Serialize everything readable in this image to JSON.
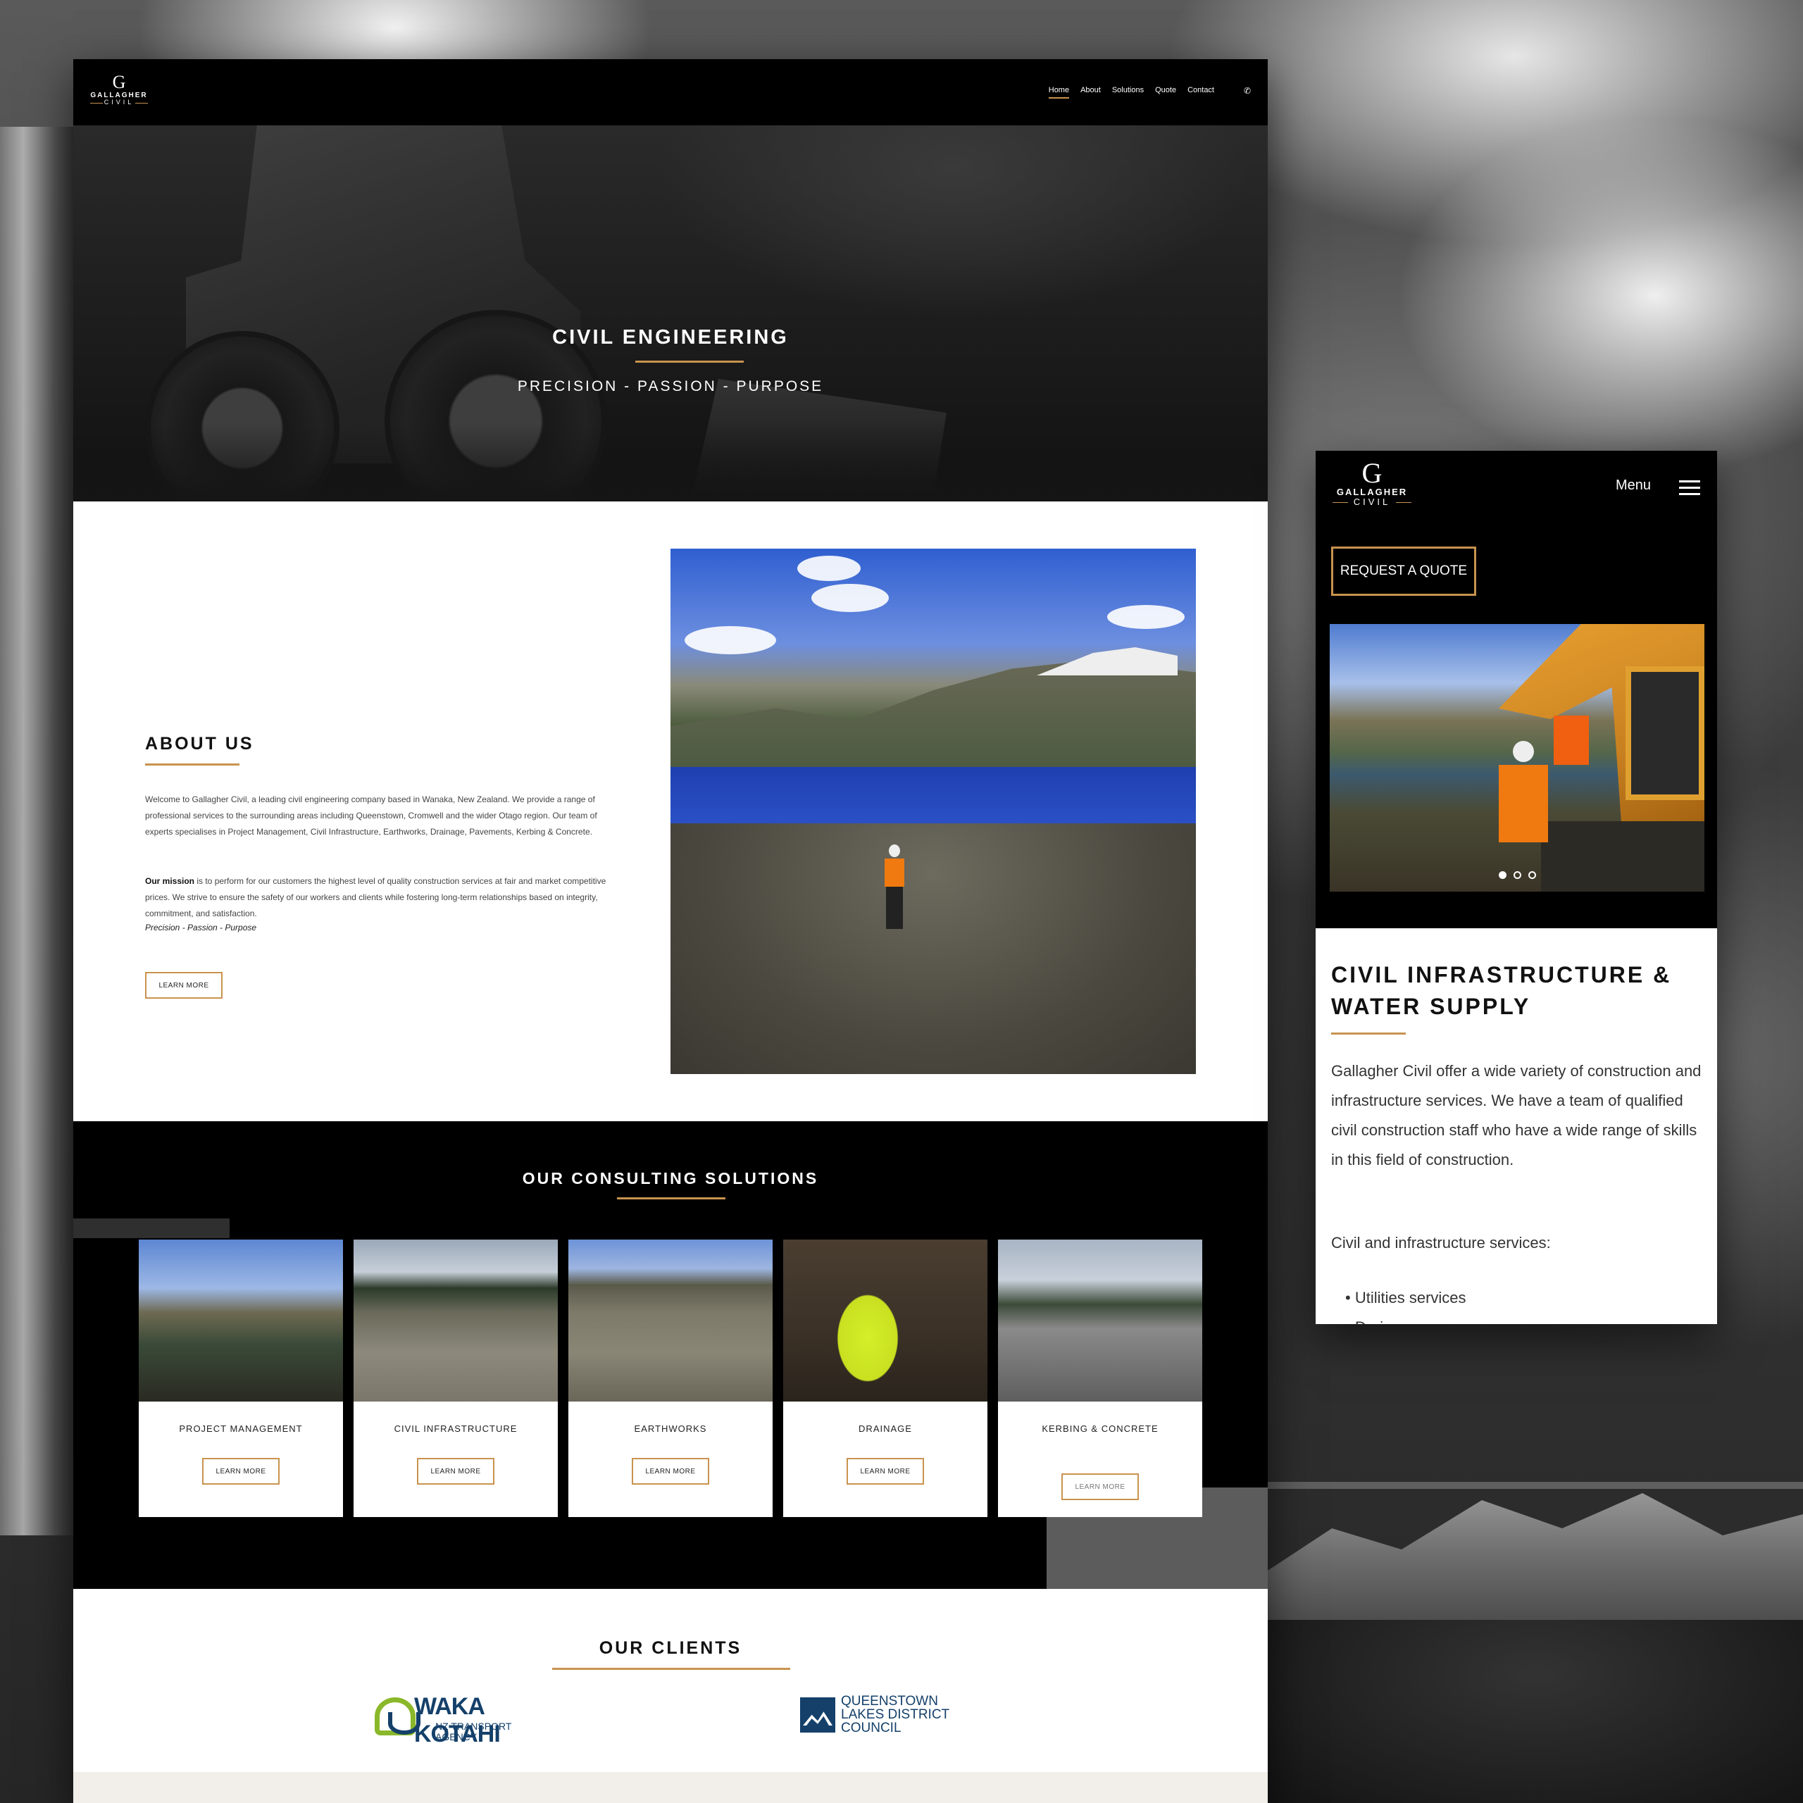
{
  "brand": {
    "logo_letter": "G",
    "logo_name": "GALLAGHER",
    "logo_sub": "CIVIL"
  },
  "nav": {
    "items": [
      {
        "label": "Home",
        "active": true
      },
      {
        "label": "About",
        "active": false
      },
      {
        "label": "Solutions",
        "active": false
      },
      {
        "label": "Quote",
        "active": false
      },
      {
        "label": "Contact",
        "active": false
      }
    ],
    "phone_icon": "phone-icon"
  },
  "hero": {
    "title": "CIVIL ENGINEERING",
    "subtitle": "PRECISION - PASSION - PURPOSE"
  },
  "about": {
    "title": "ABOUT US",
    "paragraph1": "Welcome to Gallagher Civil, a leading civil engineering company based in Wanaka, New Zealand. We provide a range of professional services to the surrounding areas including Queenstown, Cromwell and the wider Otago region. Our team of experts specialises in Project Management, Civil Infrastructure, Earthworks, Drainage, Pavements, Kerbing & Concrete.",
    "mission_label": "Our mission",
    "paragraph2": " is to perform for our customers the highest level of quality construction services at fair and market competitive prices. We strive to ensure the safety of our workers and clients while fostering long-term relationships based on integrity, commitment, and satisfaction.",
    "tagline": "Precision - Passion - Purpose",
    "button": "LEARN MORE"
  },
  "solutions": {
    "title": "OUR CONSULTING SOLUTIONS",
    "cards": [
      {
        "label": "PROJECT MANAGEMENT",
        "button": "LEARN MORE"
      },
      {
        "label": "CIVIL INFRASTRUCTURE",
        "button": "LEARN MORE"
      },
      {
        "label": "EARTHWORKS",
        "button": "LEARN MORE"
      },
      {
        "label": "DRAINAGE",
        "button": "LEARN MORE"
      },
      {
        "label": "KERBING & CONCRETE",
        "button": "LEARN MORE"
      }
    ]
  },
  "clients": {
    "title": "OUR CLIENTS",
    "waka": {
      "name": "WAKA KOTAHI",
      "line1": "NZ TRANSPORT",
      "line2": "AGENCY"
    },
    "qldc": {
      "line1": "QUEENSTOWN",
      "line2": "LAKES DISTRICT",
      "line3": "COUNCIL"
    }
  },
  "mobile": {
    "menu_label": "Menu",
    "quote_button": "REQUEST A QUOTE",
    "slides": 3,
    "active_slide": 1,
    "heading": "CIVIL INFRASTRUCTURE & WATER SUPPLY",
    "paragraph": "Gallagher Civil offer a wide variety of construction and infrastructure services. We have a team of qualified civil construction staff who have a wide range of skills in this field of construction.",
    "services_intro": "Civil and infrastructure services:",
    "services": [
      "Utilities services",
      "Drainage"
    ]
  },
  "colors": {
    "accent": "#c8934f",
    "dark": "#000000",
    "client_blue": "#14406a",
    "client_green": "#8ab82a"
  }
}
